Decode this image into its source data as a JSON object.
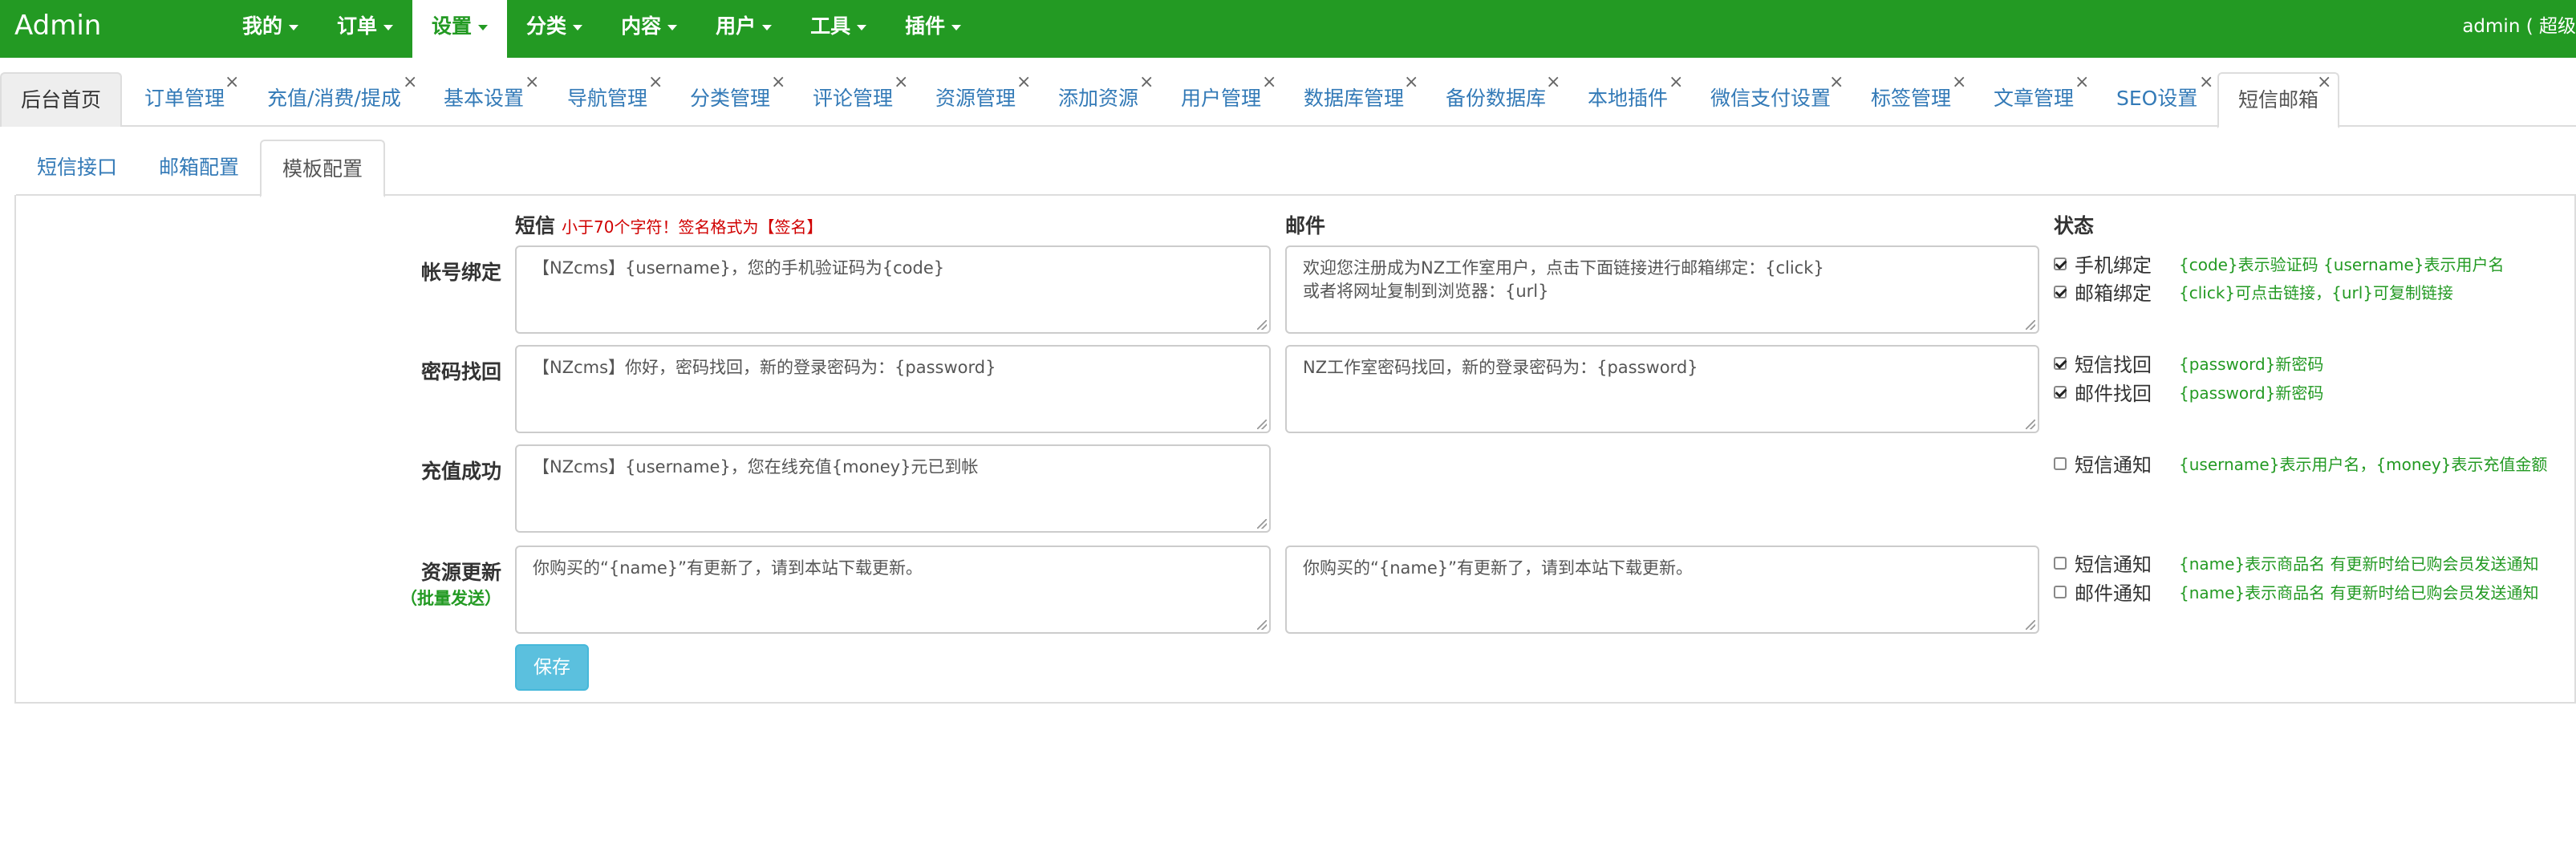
{
  "navbar": {
    "brand": "Admin",
    "menu": [
      {
        "label": "我的",
        "active": false
      },
      {
        "label": "订单",
        "active": false
      },
      {
        "label": "设置",
        "active": true
      },
      {
        "label": "分类",
        "active": false
      },
      {
        "label": "内容",
        "active": false
      },
      {
        "label": "用户",
        "active": false
      },
      {
        "label": "工具",
        "active": false
      },
      {
        "label": "插件",
        "active": false
      }
    ],
    "user": "admin ( 超级"
  },
  "tabs": {
    "home": "后台首页",
    "items": [
      "订单管理",
      "充值/消费/提成",
      "基本设置",
      "导航管理",
      "分类管理",
      "评论管理",
      "资源管理",
      "添加资源",
      "用户管理",
      "数据库管理",
      "备份数据库",
      "本地插件",
      "微信支付设置",
      "标签管理",
      "文章管理",
      "SEO设置",
      "短信邮箱"
    ],
    "close_glyph": "×"
  },
  "subtabs": [
    "短信接口",
    "邮箱配置",
    "模板配置"
  ],
  "columns": {
    "sms": "短信",
    "sms_hint": "小于70个字符！签名格式为【签名】",
    "email": "邮件",
    "status": "状态"
  },
  "rows": {
    "bind": {
      "label": "帐号绑定",
      "sms": "【NZcms】{username}，您的手机验证码为{code}",
      "email": "欢迎您注册成为NZ工作室用户，点击下面链接进行邮箱绑定：{click}\n或者将网址复制到浏览器：{url}",
      "checks": [
        {
          "label": "手机绑定",
          "checked": true,
          "note": "{code}表示验证码 {username}表示用户名"
        },
        {
          "label": "邮箱绑定",
          "checked": true,
          "note": "{click}可点击链接，{url}可复制链接"
        }
      ]
    },
    "password": {
      "label": "密码找回",
      "sms": "【NZcms】你好，密码找回，新的登录密码为：{password}",
      "email": "NZ工作室密码找回，新的登录密码为：{password}",
      "checks": [
        {
          "label": "短信找回",
          "checked": true,
          "note": "{password}新密码"
        },
        {
          "label": "邮件找回",
          "checked": true,
          "note": "{password}新密码"
        }
      ]
    },
    "recharge": {
      "label": "充值成功",
      "sms": "【NZcms】{username}，您在线充值{money}元已到帐",
      "checks": [
        {
          "label": "短信通知",
          "checked": false,
          "note": "{username}表示用户名，{money}表示充值金额"
        }
      ]
    },
    "update": {
      "label": "资源更新",
      "sublabel": "（批量发送）",
      "sms": "你购买的“{name}”有更新了，请到本站下载更新。",
      "email": "你购买的“{name}”有更新了，请到本站下载更新。",
      "checks": [
        {
          "label": "短信通知",
          "checked": false,
          "note": "{name}表示商品名 有更新时给已购会员发送通知"
        },
        {
          "label": "邮件通知",
          "checked": false,
          "note": "{name}表示商品名 有更新时给已购会员发送通知"
        }
      ]
    }
  },
  "save_label": "保存",
  "colors": {
    "brand_green": "#239a23",
    "hint_red": "#d00000",
    "link_blue": "#337ab7",
    "button_info": "#5bc0de"
  }
}
